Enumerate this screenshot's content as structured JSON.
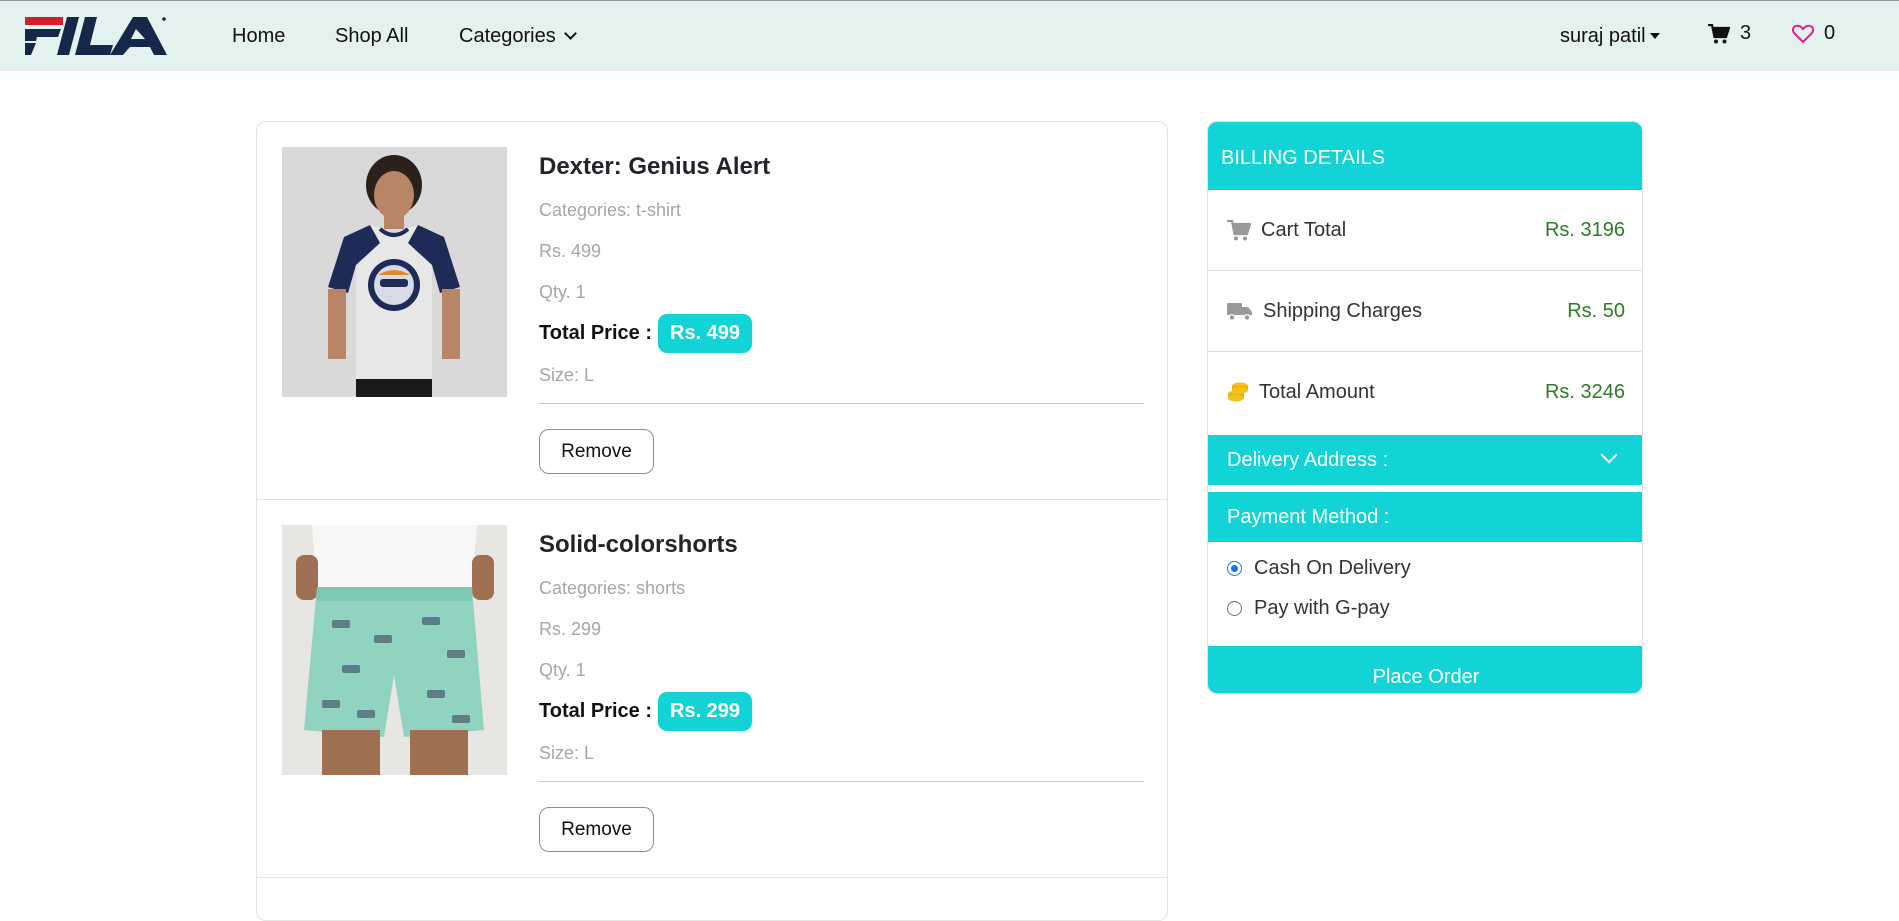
{
  "brand": {
    "logo_text": "FILA",
    "colors": {
      "red": "#d1202a",
      "navy": "#16284a",
      "accent": "#12d3d6",
      "price_green": "#2c7b29"
    }
  },
  "nav": {
    "home": "Home",
    "shop_all": "Shop All",
    "categories": "Categories",
    "user": "suraj patil",
    "cart_count": "3",
    "wishlist_count": "0"
  },
  "cart_items": [
    {
      "title": "Dexter: Genius Alert",
      "category": "Categories: t-shirt",
      "price": "Rs. 499",
      "qty": "Qty. 1",
      "total_label": "Total Price :",
      "total_value": "Rs. 499",
      "size": "Size: L",
      "remove_label": "Remove"
    },
    {
      "title": "Solid-colorshorts",
      "category": "Categories: shorts",
      "price": "Rs. 299",
      "qty": "Qty. 1",
      "total_label": "Total Price :",
      "total_value": "Rs. 299",
      "size": "Size: L",
      "remove_label": "Remove"
    }
  ],
  "billing": {
    "header": "BILLING DETAILS",
    "cart_total_label": "Cart Total",
    "cart_total_value": "Rs. 3196",
    "shipping_label": "Shipping Charges",
    "shipping_value": "Rs. 50",
    "total_label": "Total Amount",
    "total_value": "Rs. 3246",
    "delivery_label": "Delivery Address :",
    "payment_label": "Payment Method :",
    "payment_options": [
      "Cash On Delivery",
      "Pay with G-pay"
    ],
    "selected_payment": "Cash On Delivery",
    "place_order": "Place Order"
  },
  "icons": [
    "cart-icon",
    "heart-icon",
    "shopping-cart-icon",
    "truck-icon",
    "coins-icon",
    "chevron-down-icon",
    "caret-down-icon"
  ]
}
